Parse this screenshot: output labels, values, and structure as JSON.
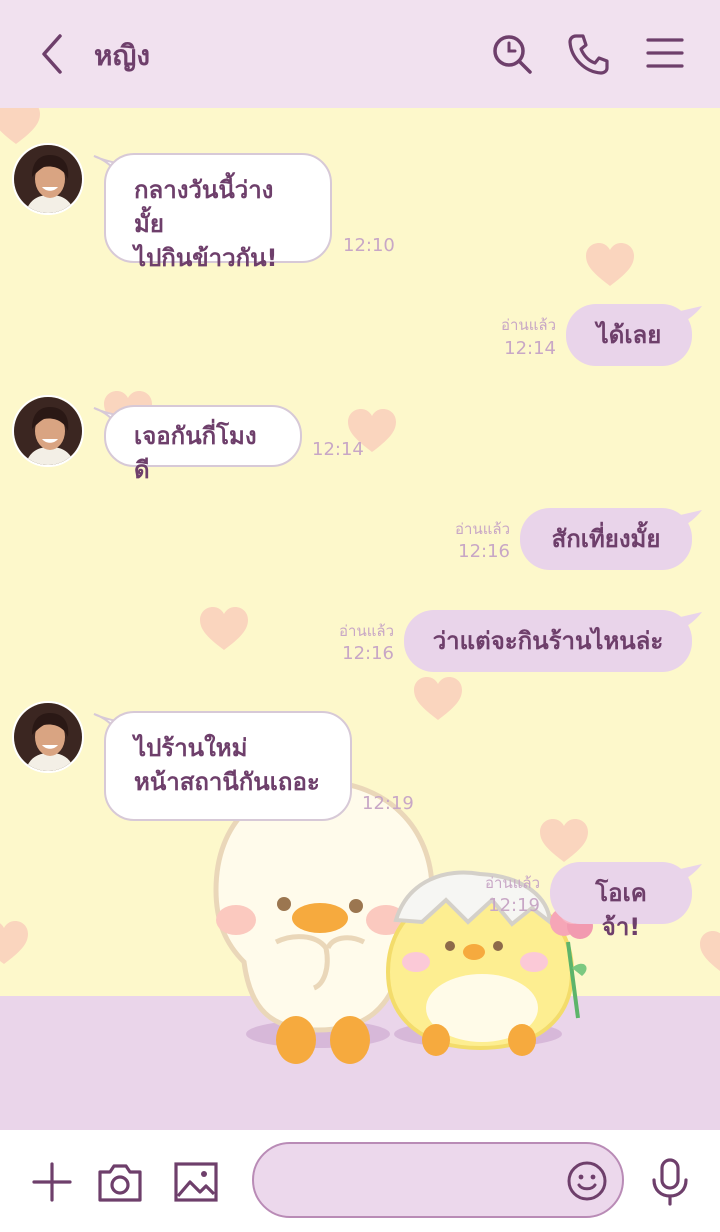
{
  "header": {
    "title": "หญิง"
  },
  "messages": [
    {
      "dir": "in",
      "lines": [
        "กลางวันนี้ว่างมั้ย",
        "ไปกินข้าวกัน!"
      ],
      "time": "12:10"
    },
    {
      "dir": "out",
      "lines": [
        "ได้เลย"
      ],
      "read": "อ่านแล้ว",
      "time": "12:14"
    },
    {
      "dir": "in",
      "lines": [
        "เจอกันกี่โมงดี"
      ],
      "time": "12:14"
    },
    {
      "dir": "out",
      "lines": [
        "สักเที่ยงมั้ย"
      ],
      "read": "อ่านแล้ว",
      "time": "12:16"
    },
    {
      "dir": "out",
      "lines": [
        "ว่าแต่จะกินร้านไหนล่ะ"
      ],
      "read": "อ่านแล้ว",
      "time": "12:16"
    },
    {
      "dir": "in",
      "lines": [
        "ไปร้านใหม่",
        "หน้าสถานีกันเถอะ"
      ],
      "time": "12:19"
    },
    {
      "dir": "out",
      "lines": [
        "โอเคจ้า!"
      ],
      "read": "อ่านแล้ว",
      "time": "12:19"
    }
  ],
  "composer": {
    "input_value": ""
  },
  "colors": {
    "accent": "#6e3f6b",
    "header_bg": "#f1e1ef",
    "chat_bg": "#fdf8cb",
    "bubble_out": "#e9d4ea"
  },
  "icons": [
    "back-arrow-icon",
    "search-history-icon",
    "phone-icon",
    "menu-icon",
    "plus-icon",
    "camera-icon",
    "image-icon",
    "emoji-icon",
    "microphone-icon"
  ]
}
